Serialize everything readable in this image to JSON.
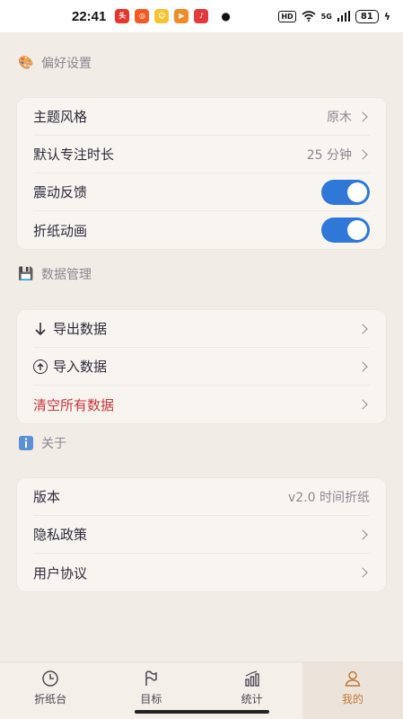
{
  "status_bar": {
    "time": "22:41",
    "hd": "HD",
    "net": "5G",
    "battery": "81"
  },
  "sections": {
    "preferences": {
      "title": "偏好设置",
      "icon": "palette-icon",
      "items": [
        {
          "label": "主题风格",
          "value": "原木"
        },
        {
          "label": "默认专注时长",
          "value": "25 分钟"
        },
        {
          "label": "震动反馈",
          "toggle": true
        },
        {
          "label": "折纸动画",
          "toggle": true
        }
      ]
    },
    "data": {
      "title": "数据管理",
      "icon": "floppy-disk-icon",
      "items": [
        {
          "label": "导出数据",
          "icon": "arrow-down-icon"
        },
        {
          "label": "导入数据",
          "icon": "circle-arrow-up-icon"
        },
        {
          "label": "清空所有数据"
        }
      ]
    },
    "about": {
      "title": "关于",
      "icon": "info-icon",
      "items": [
        {
          "label": "版本",
          "value": "v2.0 时间折纸"
        },
        {
          "label": "隐私政策"
        },
        {
          "label": "用户协议"
        }
      ]
    }
  },
  "tabs": [
    {
      "label": "折纸台",
      "icon": "clock-icon"
    },
    {
      "label": "目标",
      "icon": "flag-icon"
    },
    {
      "label": "统计",
      "icon": "bar-chart-icon"
    },
    {
      "label": "我的",
      "icon": "user-icon",
      "active": true
    }
  ],
  "colors": {
    "accent": "#2f78d8",
    "active_tab": "#c3773a",
    "danger": "#c8353b",
    "background": "#f1ece6"
  }
}
